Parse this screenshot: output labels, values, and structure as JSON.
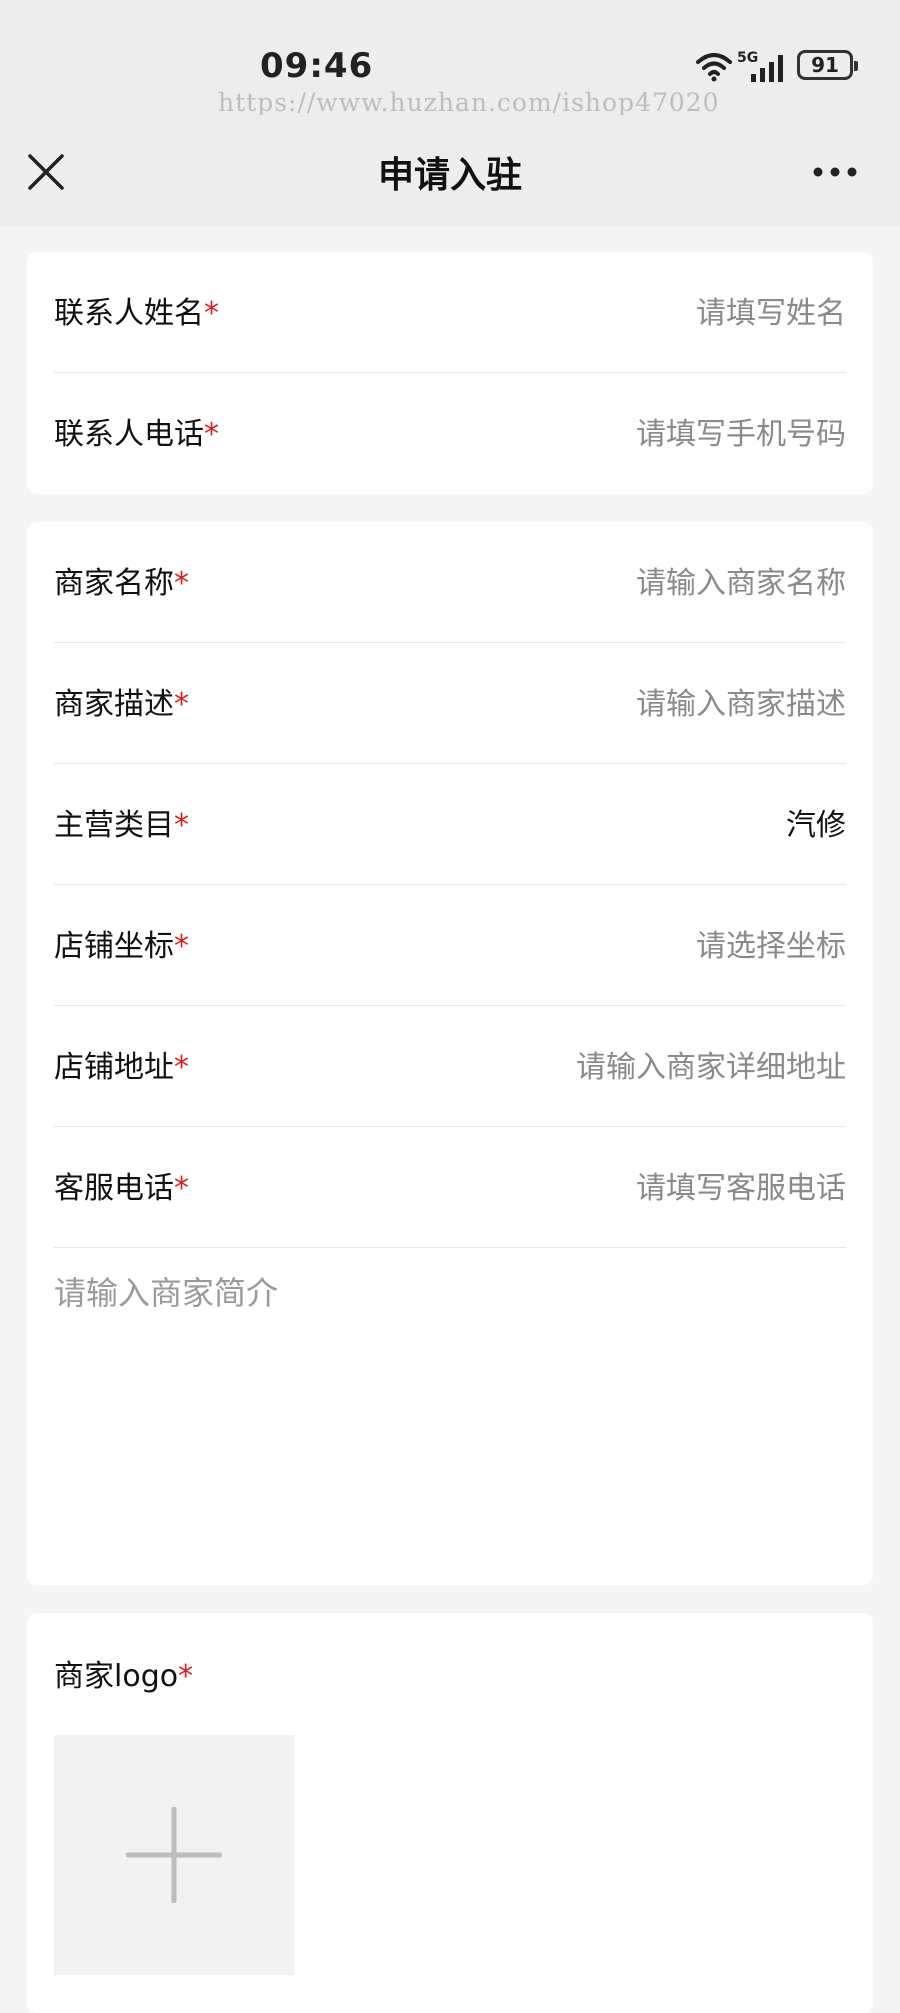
{
  "status_bar": {
    "time": "09:46",
    "network": "5G",
    "battery": "91",
    "watermark": "https://www.huzhan.com/ishop47020"
  },
  "nav": {
    "title": "申请入驻",
    "close_icon": "close-icon",
    "more_icon": "more-icon"
  },
  "contact_section": {
    "rows": [
      {
        "label": "联系人姓名",
        "required": "*",
        "placeholder": "请填写姓名"
      },
      {
        "label": "联系人电话",
        "required": "*",
        "placeholder": "请填写手机号码"
      }
    ]
  },
  "merchant_section": {
    "rows": [
      {
        "label": "商家名称",
        "required": "*",
        "placeholder": "请输入商家名称"
      },
      {
        "label": "商家描述",
        "required": "*",
        "placeholder": "请输入商家描述"
      },
      {
        "label": "主营类目",
        "required": "*",
        "value": "汽修"
      },
      {
        "label": "店铺坐标",
        "required": "*",
        "placeholder": "请选择坐标"
      },
      {
        "label": "店铺地址",
        "required": "*",
        "placeholder": "请输入商家详细地址"
      },
      {
        "label": "客服电话",
        "required": "*",
        "placeholder": "请填写客服电话"
      }
    ],
    "intro_placeholder": "请输入商家简介"
  },
  "logo_section": {
    "label": "商家logo",
    "required": "*",
    "upload_icon": "plus-icon"
  },
  "colors": {
    "required": "#d81e1e",
    "placeholder": "#8a8a8a",
    "background": "#f5f5f5",
    "header": "#ededed"
  }
}
